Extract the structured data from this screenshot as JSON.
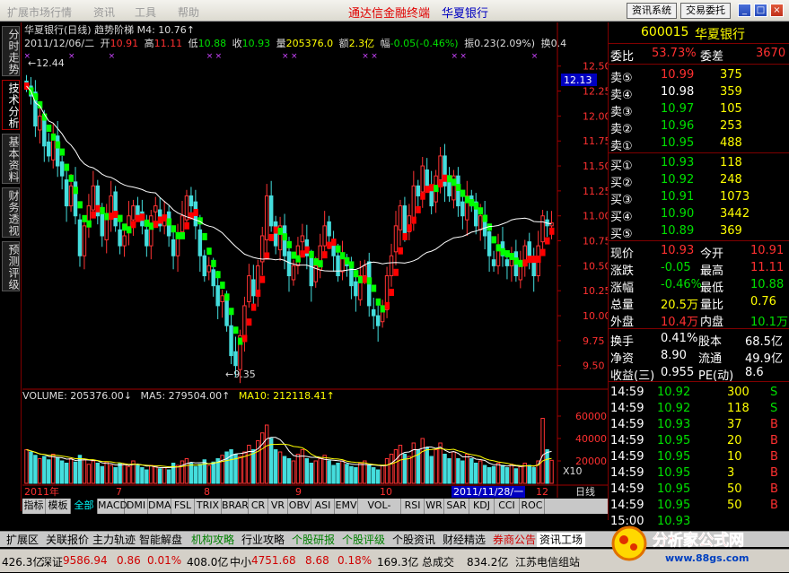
{
  "menu": {
    "items": [
      "扩展市场行情",
      "资讯",
      "工具",
      "帮助"
    ]
  },
  "app_title": "通达信金融终端",
  "stock_title": "华夏银行",
  "top_buttons": [
    "资讯系统",
    "交易委托"
  ],
  "window_buttons": [
    "_",
    "□",
    "×"
  ],
  "left_tabs": [
    "分时走势",
    "技术分析",
    "基本资料",
    "财务透视",
    "预测评级"
  ],
  "chart": {
    "header_line": "华夏银行(日线) 趋势阶梯 M4: 10.76↑",
    "ohlc_line": {
      "date": "2011/12/06/二",
      "open_label": "开",
      "open": "10.91",
      "high_label": "高",
      "high": "11.11",
      "low_label": "低",
      "low": "10.88",
      "close_label": "收",
      "close": "10.93",
      "vol_label": "量",
      "vol": "205376.0",
      "amt_label": "额",
      "amt": "2.3亿",
      "chg_label": "幅",
      "chg": "-0.05(-0.46%)",
      "amp_label": "振",
      "amp": "0.23(2.09%)",
      "turn_label": "换",
      "turn": "0.4"
    },
    "current_price_tag": "12.13",
    "high_annotation": "12.44",
    "low_annotation": "9.35",
    "volume_line": {
      "vol": "VOLUME: 205376.00↓",
      "ma5": "MA5: 279504.00↑",
      "ma10": "MA10: 212118.41↑"
    },
    "volume_axis_unit": "X10",
    "x_labels": [
      "2011年",
      "7",
      "8",
      "9",
      "10",
      "2011/11/28/一",
      "12"
    ],
    "period_label": "日线",
    "colors": {
      "up": "#ff3333",
      "down": "#44dddd",
      "ladder_up": "#ff0000",
      "ladder_down": "#00ff00",
      "ma": "#ffffff"
    }
  },
  "chart_data": {
    "type": "candlestick",
    "price_axis": {
      "ticks": [
        "12.50",
        "12.25",
        "12.00",
        "11.75",
        "11.50",
        "11.25",
        "11.00",
        "10.75",
        "10.50",
        "10.25",
        "10.00",
        "9.75",
        "9.50"
      ],
      "ylim": [
        9.3,
        12.65
      ]
    },
    "volume_axis": {
      "ticks": [
        "60000",
        "40000",
        "20000"
      ],
      "ylim": [
        0,
        72000
      ]
    },
    "close": [
      12.3,
      12.2,
      11.9,
      12.0,
      11.7,
      11.6,
      11.8,
      11.5,
      11.4,
      11.1,
      11.3,
      11.0,
      10.6,
      10.9,
      11.1,
      11.3,
      11.0,
      10.8,
      11.0,
      11.2,
      10.9,
      10.7,
      10.8,
      11.0,
      11.1,
      11.0,
      10.9,
      10.7,
      11.0,
      11.1,
      10.9,
      11.0,
      10.8,
      10.6,
      10.8,
      11.0,
      11.2,
      11.1,
      10.9,
      10.6,
      10.4,
      10.5,
      10.3,
      10.1,
      10.2,
      9.9,
      9.6,
      9.5,
      9.8,
      10.1,
      10.4,
      10.2,
      10.5,
      10.8,
      11.2,
      10.9,
      10.7,
      10.9,
      10.6,
      10.4,
      10.5,
      10.7,
      10.8,
      10.6,
      10.3,
      10.5,
      10.7,
      10.9,
      10.8,
      10.6,
      10.4,
      10.6,
      10.5,
      10.3,
      10.2,
      10.4,
      10.5,
      10.1,
      10.0,
      9.9,
      10.1,
      10.4,
      10.6,
      10.9,
      11.1,
      10.8,
      11.0,
      11.3,
      11.2,
      11.5,
      11.3,
      11.1,
      11.4,
      11.6,
      11.3,
      11.2,
      11.4,
      11.1,
      11.0,
      11.2,
      11.1,
      10.9,
      11.0,
      10.8,
      10.6,
      10.5,
      10.7,
      10.6,
      10.5,
      10.6,
      10.4,
      10.5,
      10.7,
      10.6,
      10.4,
      10.7,
      11.0,
      10.9,
      10.93
    ],
    "volume": [
      30000,
      28000,
      25000,
      22000,
      24000,
      21000,
      26000,
      23000,
      20000,
      18000,
      22000,
      19000,
      25000,
      21000,
      17000,
      20000,
      18000,
      15000,
      19000,
      16000,
      14000,
      18000,
      17000,
      15000,
      20000,
      16000,
      14000,
      12000,
      16000,
      15000,
      13000,
      14000,
      12000,
      18000,
      16000,
      20000,
      22000,
      18000,
      15000,
      17000,
      21000,
      16000,
      19000,
      22000,
      25000,
      28000,
      30000,
      26000,
      24000,
      28000,
      34000,
      30000,
      38000,
      45000,
      52000,
      40000,
      30000,
      28000,
      24000,
      22000,
      20000,
      26000,
      30000,
      22000,
      18000,
      20000,
      22000,
      25000,
      20000,
      16000,
      18000,
      20000,
      17000,
      15000,
      14000,
      18000,
      20000,
      16000,
      14000,
      12000,
      16000,
      22000,
      26000,
      30000,
      34000,
      26000,
      24000,
      36000,
      30000,
      40000,
      32000,
      24000,
      30000,
      36000,
      26000,
      22000,
      28000,
      22000,
      20000,
      26000,
      22000,
      18000,
      20000,
      16000,
      14000,
      15000,
      18000,
      16000,
      14000,
      17000,
      13000,
      15000,
      18000,
      16000,
      14000,
      20000,
      58000,
      30000,
      20537
    ]
  },
  "bottom_tabs": [
    "指标",
    "模板",
    "全部",
    "MACD",
    "DMI",
    "DMA",
    "FSL",
    "TRIX",
    "BRAR",
    "CR",
    "VR",
    "OBV",
    "ASI",
    "EMV",
    "VOL-TDX",
    "RSI",
    "WR",
    "SAR",
    "KDJ",
    "CCI",
    "ROC"
  ],
  "quote": {
    "code": "600015",
    "name": "华夏银行",
    "wei_bi_label": "委比",
    "wei_bi": "53.73%",
    "wei_cha_label": "委差",
    "wei_cha": "3670",
    "asks": [
      {
        "label": "卖⑤",
        "price": "10.99",
        "vol": "375"
      },
      {
        "label": "卖④",
        "price": "10.98",
        "vol": "359"
      },
      {
        "label": "卖③",
        "price": "10.97",
        "vol": "105"
      },
      {
        "label": "卖②",
        "price": "10.96",
        "vol": "253"
      },
      {
        "label": "卖①",
        "price": "10.95",
        "vol": "488"
      }
    ],
    "bids": [
      {
        "label": "买①",
        "price": "10.93",
        "vol": "118"
      },
      {
        "label": "买②",
        "price": "10.92",
        "vol": "248"
      },
      {
        "label": "买③",
        "price": "10.91",
        "vol": "1073"
      },
      {
        "label": "买④",
        "price": "10.90",
        "vol": "3442"
      },
      {
        "label": "买⑤",
        "price": "10.89",
        "vol": "369"
      }
    ],
    "stats": [
      {
        "l1": "现价",
        "v1": "10.93",
        "c1": "red",
        "l2": "今开",
        "v2": "10.91",
        "c2": "red"
      },
      {
        "l1": "涨跌",
        "v1": "-0.05",
        "c1": "green",
        "l2": "最高",
        "v2": "11.11",
        "c2": "red"
      },
      {
        "l1": "涨幅",
        "v1": "-0.46%",
        "c1": "green",
        "l2": "最低",
        "v2": "10.88",
        "c2": "green"
      },
      {
        "l1": "总量",
        "v1": "20.5万",
        "c1": "yellow",
        "l2": "量比",
        "v2": "0.76",
        "c2": "yellow"
      },
      {
        "l1": "外盘",
        "v1": "10.4万",
        "c1": "red",
        "l2": "内盘",
        "v2": "10.1万",
        "c2": "green"
      }
    ],
    "fundamentals": [
      {
        "l1": "换手",
        "v1": "0.41%",
        "l2": "股本",
        "v2": "68.5亿"
      },
      {
        "l1": "净资",
        "v1": "8.90",
        "l2": "流通",
        "v2": "49.9亿"
      },
      {
        "l1": "收益(三)",
        "v1": "0.955",
        "l2": "PE(动)",
        "v2": "8.6"
      }
    ],
    "ticks": [
      {
        "time": "14:59",
        "price": "10.92",
        "pc": "green",
        "vol": "300",
        "side": "S"
      },
      {
        "time": "14:59",
        "price": "10.92",
        "pc": "green",
        "vol": "118",
        "side": "S"
      },
      {
        "time": "14:59",
        "price": "10.93",
        "pc": "green",
        "vol": "37",
        "side": "B"
      },
      {
        "time": "14:59",
        "price": "10.95",
        "pc": "green",
        "vol": "20",
        "side": "B"
      },
      {
        "time": "14:59",
        "price": "10.95",
        "pc": "green",
        "vol": "10",
        "side": "B"
      },
      {
        "time": "14:59",
        "price": "10.95",
        "pc": "green",
        "vol": "3",
        "side": "B"
      },
      {
        "time": "14:59",
        "price": "10.95",
        "pc": "green",
        "vol": "50",
        "side": "B"
      },
      {
        "time": "14:59",
        "price": "10.95",
        "pc": "green",
        "vol": "50",
        "side": "B"
      },
      {
        "time": "15:00",
        "price": "10.93",
        "pc": "green",
        "vol": "",
        "side": ""
      }
    ]
  },
  "bottom_nav": [
    "扩展区",
    "关联报价",
    "主力轨迹",
    "智能解盘",
    "机构攻略",
    "行业攻略",
    "个股研报",
    "个股评级",
    "个股资讯",
    "财经精选",
    "券商公告",
    "资讯工场"
  ],
  "status": {
    "a": "426.3亿",
    "sz_label": "深证",
    "sz": "9586.94",
    "sz_chg": "0.86",
    "sz_pct": "0.01%",
    "sz_amt": "408.0亿",
    "zx_label": "中小",
    "zx": "4751.68",
    "zx_chg": "8.68",
    "zx_pct": "0.18%",
    "zx_amt": "169.3亿",
    "zx2": "834.2亿",
    "msg": "总成交",
    "isp": "江苏电信组站"
  },
  "watermark": {
    "text": "分析家公式网",
    "url": "www.88gs.com"
  }
}
